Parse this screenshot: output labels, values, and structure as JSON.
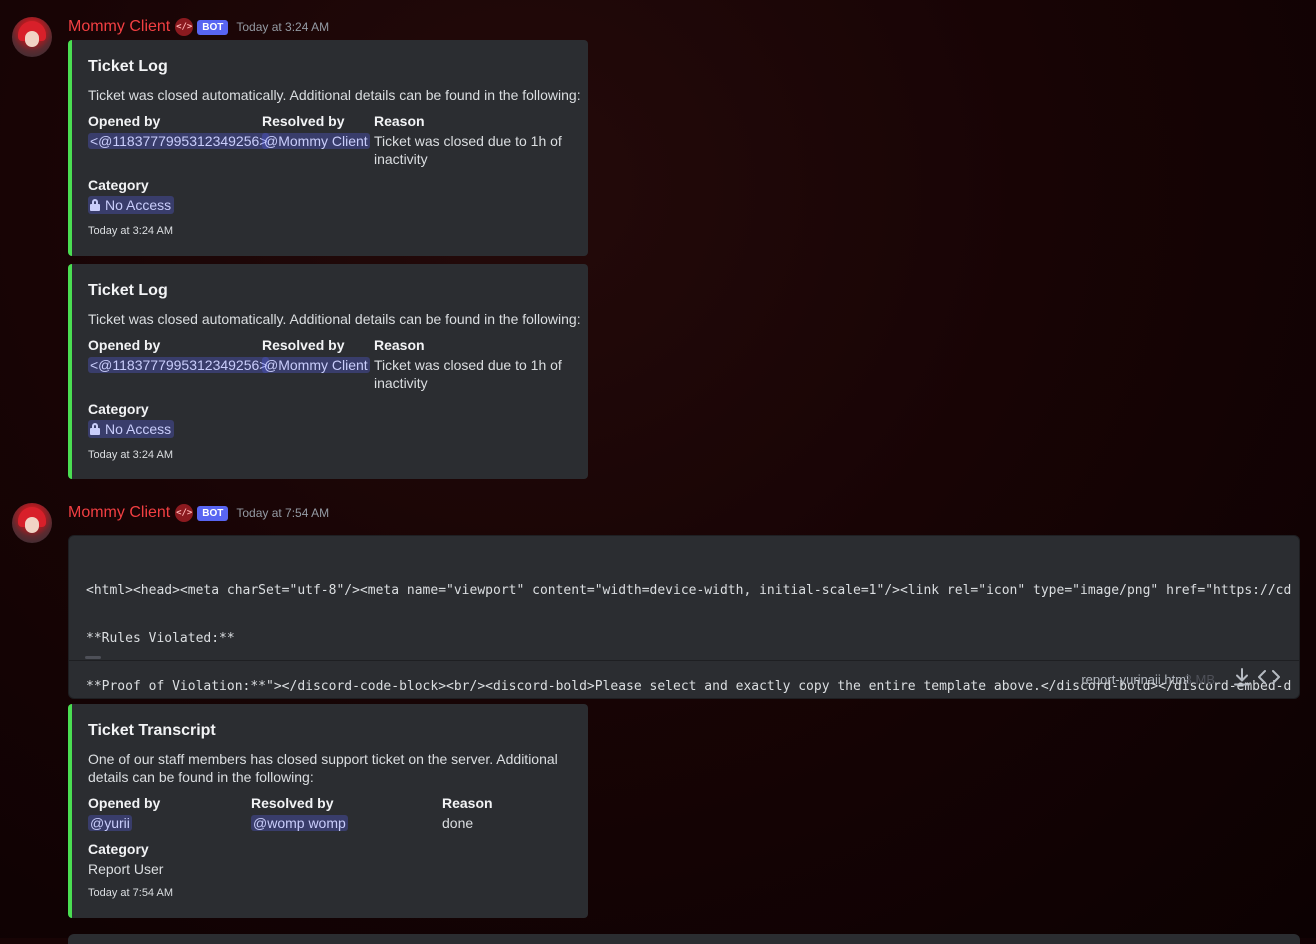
{
  "messages": [
    {
      "username": "Mommy Client",
      "bot_tag": "BOT",
      "timestamp": "Today at 3:24 AM",
      "embeds": [
        {
          "title": "Ticket Log",
          "description": "Ticket was closed automatically. Additional details can be found in the following:",
          "fields": {
            "opened_by_label": "Opened by",
            "opened_by_value": "<@1183777995312349256>",
            "resolved_by_label": "Resolved by",
            "resolved_by_value": "@Mommy Client",
            "reason_label": "Reason",
            "reason_line1": "Ticket was closed due to 1h of",
            "reason_line2": "inactivity",
            "category_label": "Category",
            "category_value": "No Access"
          },
          "footer": "Today at 3:24 AM"
        },
        {
          "title": "Ticket Log",
          "description": "Ticket was closed automatically. Additional details can be found in the following:",
          "fields": {
            "opened_by_label": "Opened by",
            "opened_by_value": "<@1183777995312349256>",
            "resolved_by_label": "Resolved by",
            "resolved_by_value": "@Mommy Client",
            "reason_label": "Reason",
            "reason_line1": "Ticket was closed due to 1h of",
            "reason_line2": "inactivity",
            "category_label": "Category",
            "category_value": "No Access"
          },
          "footer": "Today at 3:24 AM"
        }
      ]
    },
    {
      "username": "Mommy Client",
      "bot_tag": "BOT",
      "timestamp": "Today at 7:54 AM",
      "attachment": {
        "lines": [
          "<html><head><meta charSet=\"utf-8\"/><meta name=\"viewport\" content=\"width=device-width, initial-scale=1\"/><link rel=\"icon\" type=\"image/png\" href=\"https://cdn.d",
          "**Rules Violated:**",
          "**Proof of Violation:**\"></discord-code-block><br/><discord-bold>Please select and exactly copy the entire template above.</discord-bold></discord-embed-desc"
        ],
        "file_name": "report-yurinaii.html",
        "file_size": "3 MB"
      },
      "embed": {
        "title": "Ticket Transcript",
        "description_line1": "One of our staff members has closed support ticket on the server. Additional",
        "description_line2": "details can be found in the following:",
        "fields": {
          "opened_by_label": "Opened by",
          "opened_by_value": "@yurii",
          "resolved_by_label": "Resolved by",
          "resolved_by_value": "@womp womp",
          "reason_label": "Reason",
          "reason_value": "done",
          "category_label": "Category",
          "category_value": "Report User"
        },
        "footer": "Today at 7:54 AM"
      }
    }
  ],
  "colors": {
    "username": "#f23f42",
    "embed_border": "#4ade52",
    "bot_tag": "#5865f2",
    "embed_bg": "#2b2d31"
  },
  "icons": [
    "developer-badge-icon",
    "lock-icon",
    "download-icon",
    "code-view-icon"
  ]
}
